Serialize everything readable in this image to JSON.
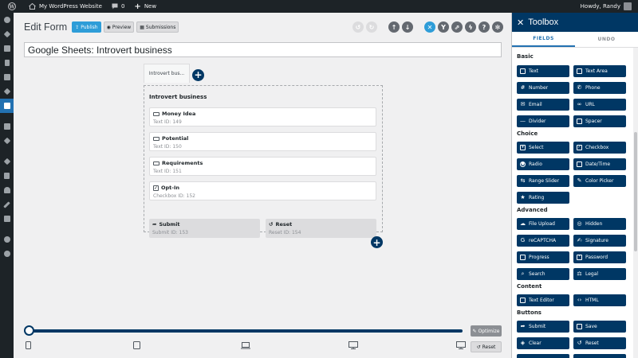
{
  "adminbar": {
    "site_name": "My WordPress Website",
    "comments_count": "0",
    "new_label": "New",
    "howdy": "Howdy, Randy"
  },
  "sidemenu": {
    "icons": [
      "dashboard-icon",
      "pin-icon",
      "media-icon",
      "pages-icon",
      "comments-icon",
      "pin-icon",
      "forms-icon",
      "feedback-icon",
      "box-icon",
      "appearance-icon",
      "plugins-icon",
      "users-icon",
      "tools-icon",
      "settings-icon",
      "circle-icon",
      "play-icon"
    ]
  },
  "editor": {
    "title": "Edit Form",
    "publish_label": "Publish",
    "preview_label": "Preview",
    "submissions_label": "Submissions",
    "form_title": "Google Sheets: Introvert business",
    "tab_label": "Introvert bus...",
    "page_title": "Introvert business",
    "fields": [
      {
        "label": "Money Idea",
        "meta": "Text   ID: 149"
      },
      {
        "label": "Potential",
        "meta": "Text   ID: 150"
      },
      {
        "label": "Requirements",
        "meta": "Text   ID: 151"
      },
      {
        "label": "Opt-In",
        "meta": "Checkbox   ID: 152"
      }
    ],
    "buttons": [
      {
        "label": "Submit",
        "meta": "Submit   ID: 153"
      },
      {
        "label": "Reset",
        "meta": "Reset   ID: 154"
      }
    ],
    "optimize_label": "Optimize",
    "reset_label": "Reset",
    "slider_value": 0
  },
  "toolbox": {
    "title": "Toolbox",
    "tabs": [
      "FIELDS",
      "UNDO"
    ],
    "groups": {
      "basic": "Basic",
      "choice": "Choice",
      "advanced": "Advanced",
      "content": "Content",
      "buttons": "Buttons"
    },
    "basic": [
      "Text",
      "Text Area",
      "Number",
      "Phone",
      "Email",
      "URL",
      "Divider",
      "Spacer"
    ],
    "choice": [
      "Select",
      "Checkbox",
      "Radio",
      "Date/Time",
      "Range Slider",
      "Color Picker",
      "Rating"
    ],
    "advanced": [
      "File Upload",
      "Hidden",
      "reCAPTCHA",
      "Signature",
      "Progress",
      "Password",
      "Search",
      "Legal"
    ],
    "content": [
      "Text Editor",
      "HTML"
    ],
    "buttons": [
      "Submit",
      "Save",
      "Clear",
      "Reset",
      "",
      ""
    ]
  },
  "colors": {
    "navy": "#003764",
    "publish_blue": "#2e9dd8",
    "admin_dark": "#1d2327"
  }
}
